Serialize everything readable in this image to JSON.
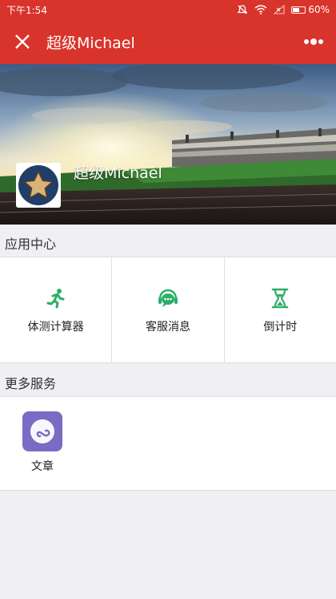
{
  "status_bar": {
    "time": "下午1:54",
    "battery_text": "60%",
    "battery_level": 0.6,
    "icons": [
      "mute-icon",
      "wifi-icon",
      "signal-icon",
      "battery-icon"
    ]
  },
  "nav": {
    "title": "超级Michael",
    "close_icon": "close-icon",
    "more_icon": "more-icon"
  },
  "banner": {
    "name": "超级Michael",
    "avatar_icon": "star-icon"
  },
  "app_center": {
    "title": "应用中心",
    "items": [
      {
        "label": "体测计算器",
        "icon": "running-person-icon"
      },
      {
        "label": "客服消息",
        "icon": "headset-chat-icon"
      },
      {
        "label": "倒计时",
        "icon": "hourglass-icon"
      }
    ]
  },
  "more_services": {
    "title": "更多服务",
    "items": [
      {
        "label": "文章",
        "icon": "mini-program-icon"
      }
    ]
  },
  "colors": {
    "brand_red": "#d9342b",
    "icon_green": "#2aae67",
    "service_purple": "#7a6bc4",
    "avatar_navy": "#1f3f68",
    "star_tan": "#d9b27a"
  }
}
